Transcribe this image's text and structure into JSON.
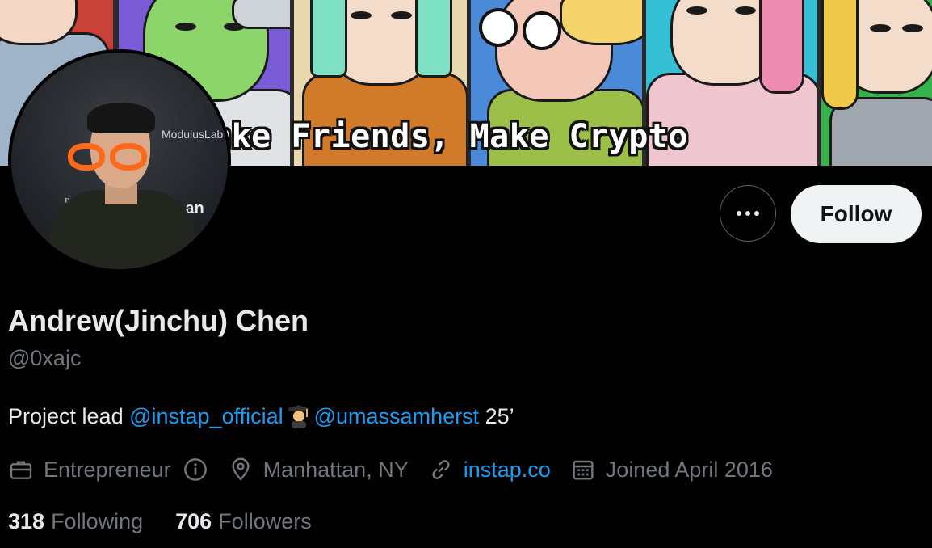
{
  "banner": {
    "text": "ake Friends, Make Crypto",
    "panel_colors": [
      "#c8423a",
      "#7a5bd6",
      "#e8d9b0",
      "#4a8ad8",
      "#d8d4cf",
      "#36c0d6",
      "#35b34a"
    ]
  },
  "avatar": {
    "backdrop_text_1": "ModulusLab",
    "backdrop_text_2": "⊙ an",
    "backdrop_text_3": "POI"
  },
  "actions": {
    "more_icon": "more-horizontal-icon",
    "follow_label": "Follow"
  },
  "profile": {
    "display_name": "Andrew(Jinchu) Chen",
    "handle": "@0xajc",
    "bio": {
      "prefix": "Project lead ",
      "mention_1": "@instap_official",
      "emoji": "student-emoji",
      "mention_2": "@umassamherst",
      "suffix": " 25’"
    },
    "meta": {
      "category": "Entrepreneur",
      "location": "Manhattan, NY",
      "website": "instap.co",
      "joined": "Joined April 2016"
    },
    "stats": {
      "following_count": "318",
      "following_label": "Following",
      "followers_count": "706",
      "followers_label": "Followers"
    }
  },
  "colors": {
    "background": "#000000",
    "text_primary": "#e7e9ea",
    "text_secondary": "#71767b",
    "link": "#1d9bf0",
    "follow_button_bg": "#eff3f4"
  }
}
